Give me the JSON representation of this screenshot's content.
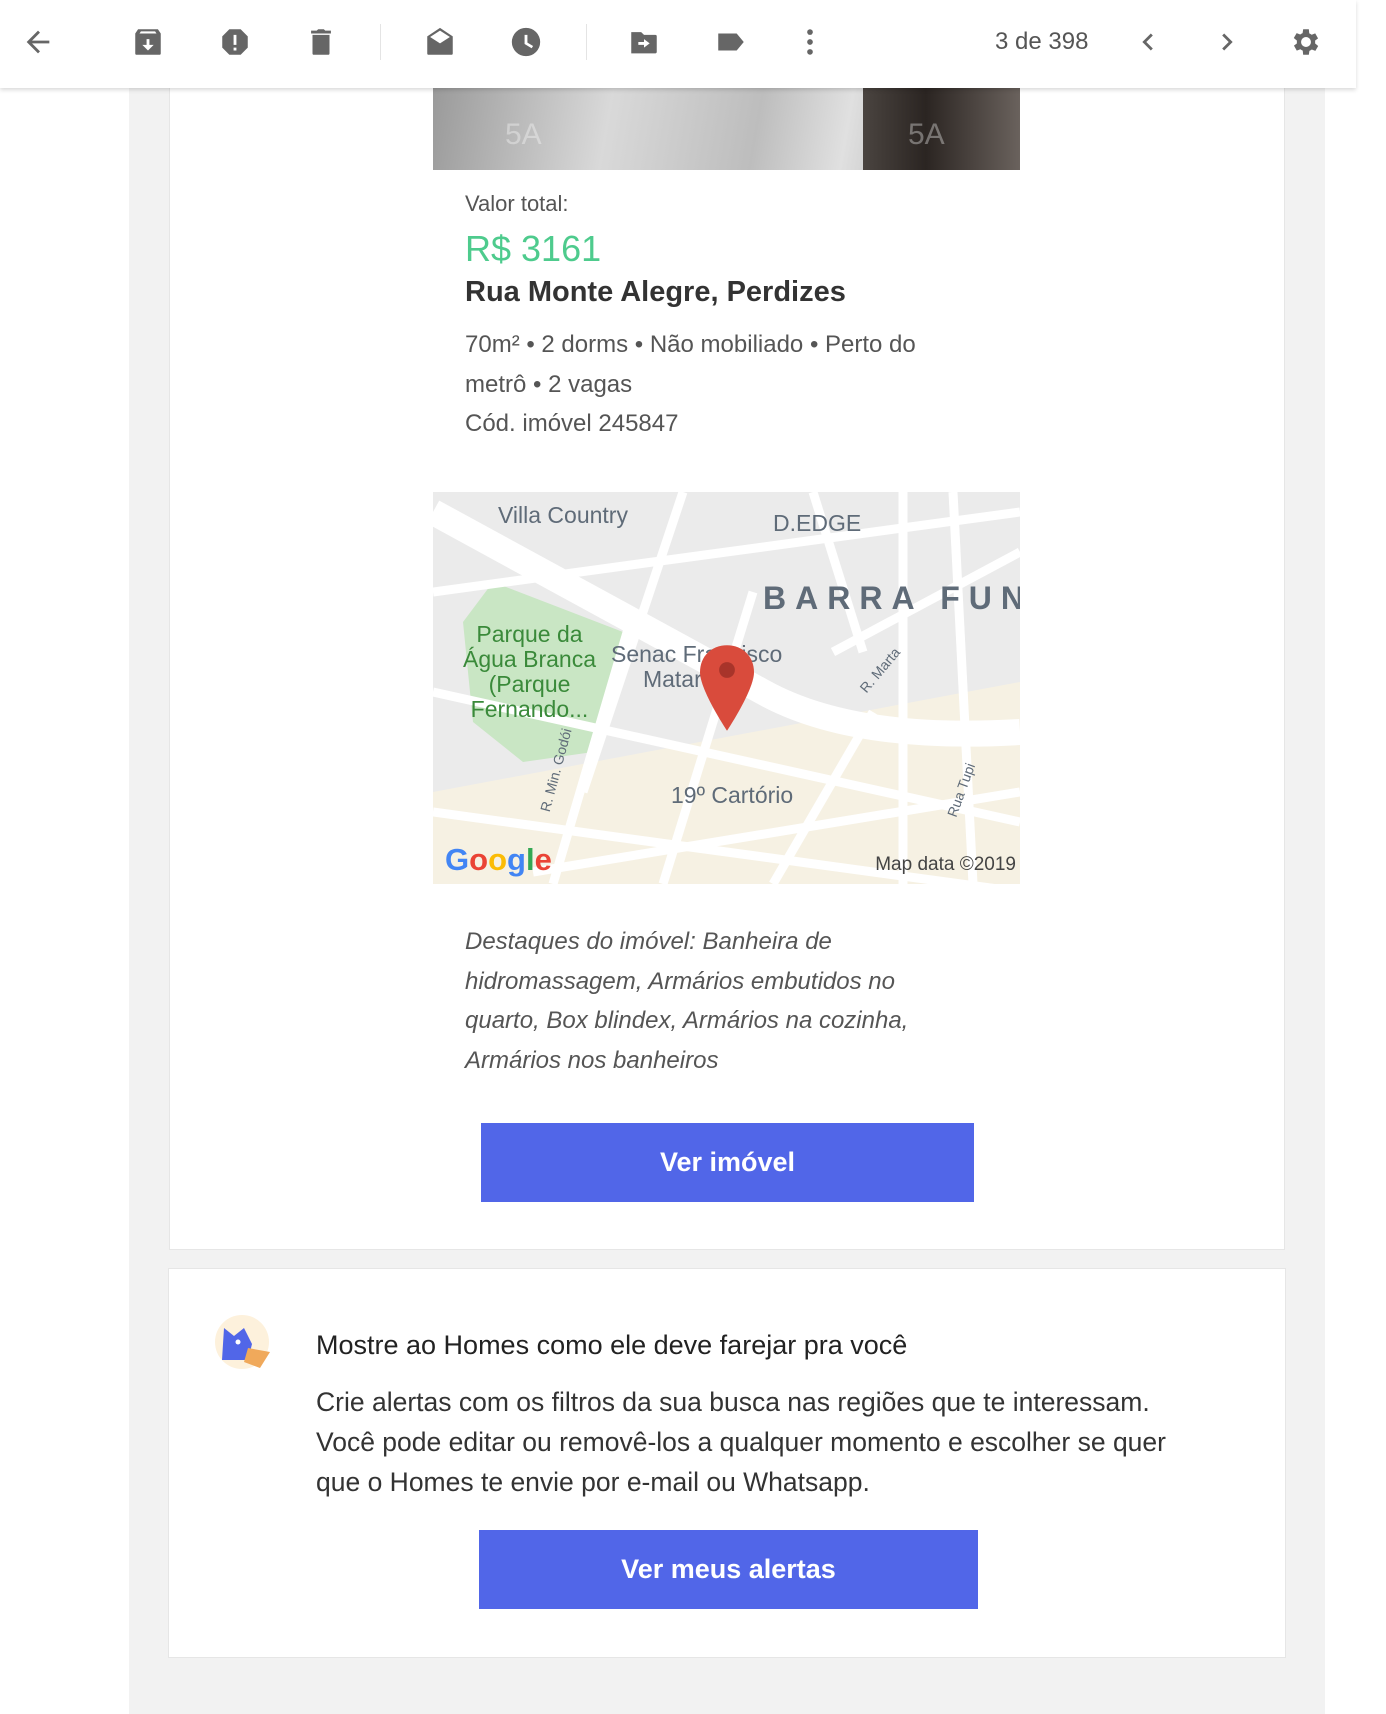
{
  "toolbar": {
    "count": "3 de 398"
  },
  "listing": {
    "total_label": "Valor total:",
    "price": "R$ 3161",
    "address": "Rua Monte Alegre, Perdizes",
    "features_line1": "70m² • 2 dorms • Não mobiliado • Perto do",
    "features_line2": "metrô • 2 vagas",
    "code": "Cód. imóvel 245847",
    "photo_watermark": "5A",
    "highlights_lines": [
      "Destaques do imóvel: Banheira de",
      "hidromassagem, Armários embutidos no",
      "quarto, Box blindex, Armários na cozinha,",
      "Armários nos banheiros"
    ],
    "button": "Ver imóvel"
  },
  "map": {
    "labels": {
      "villa": "Villa Country",
      "dedge": "D.EDGE",
      "barra": "BARRA FUN",
      "parque1": "Parque da",
      "parque2": "Água Branca",
      "parque3": "(Parque",
      "parque4": "Fernando...",
      "senac1": "Senac Francisco",
      "senac2": "Matarazzo",
      "cartorio": "19º Cartório",
      "marta": "R. Marta",
      "godoi": "R. Min. Godói",
      "tupi": "Rua Tupi"
    },
    "google": "Google",
    "attribution": "Map data ©2019"
  },
  "alerts": {
    "title": "Mostre ao Homes como ele deve farejar pra você",
    "lines": [
      "Crie alertas com os filtros da sua busca nas regiões que te interessam.",
      "Você pode editar ou removê-los a qualquer momento e escolher se quer",
      "que o Homes te envie por e-mail ou Whatsapp."
    ],
    "button": "Ver meus alertas"
  },
  "colors": {
    "accent": "#5166e8",
    "price": "#4ecb8d"
  }
}
